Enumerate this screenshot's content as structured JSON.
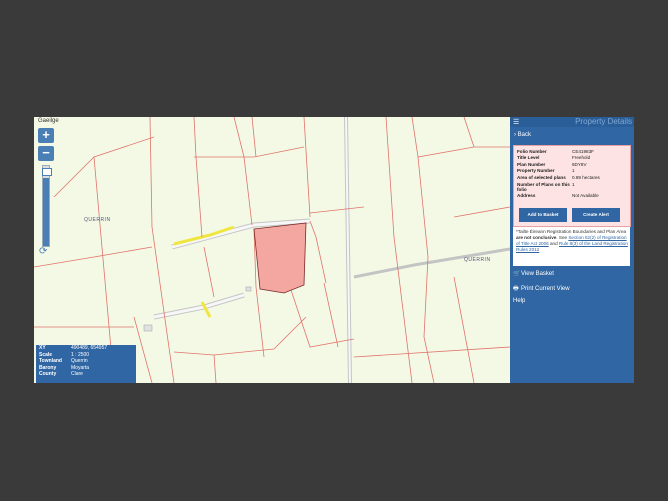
{
  "map": {
    "language_link": "Gaeilge",
    "zoom_in": "+",
    "zoom_out": "−",
    "refresh_icon": "⟳",
    "townland_labels": [
      "QUERRIN",
      "QUERRIN"
    ],
    "info": [
      {
        "key": "XY",
        "value": "490489, 654957"
      },
      {
        "key": "Scale",
        "value": "1 : 2500"
      },
      {
        "key": "Townland",
        "value": "Querrin"
      },
      {
        "key": "Barony",
        "value": "Moyarta"
      },
      {
        "key": "County",
        "value": "Clare"
      }
    ],
    "colors": {
      "background": "#f4f9e6",
      "parcel_line": "#e0736a",
      "selected_fill": "#f4a6a0",
      "road": "#b8b8b8",
      "highlight": "#f0e640"
    }
  },
  "panel": {
    "menu_icon": "☰",
    "title": "Property Details",
    "back_label": "Back",
    "back_icon": "›",
    "details": [
      {
        "key": "Folio Number",
        "value": "CE41983F"
      },
      {
        "key": "Title Level",
        "value": "Freehold"
      },
      {
        "key": "Plan Number",
        "value": "6DY8V"
      },
      {
        "key": "Property Number",
        "value": "1"
      },
      {
        "key": "Area of selected plans",
        "value": "0.89 hectares"
      },
      {
        "key": "Number of Plans on this folio",
        "value": "1"
      },
      {
        "key": "Address",
        "value": "Not Available"
      }
    ],
    "add_to_basket": "Add to Basket",
    "create_alert": "Create Alert",
    "note": {
      "text1": "*Tailte Éireann Registration Boundaries and Plan Area",
      "bold": "are not conclusive",
      "text2": ". See",
      "link1": "Section 62(2) of Registration of Title Act 2006",
      "text3": "and",
      "link2": "Rule 8(3) of the Land Registration Rules 2012"
    },
    "view_basket": "View Basket",
    "print_view": "Print Current View",
    "help": "Help",
    "colors": {
      "panel": "#2f66a3",
      "card": "#fde3e3"
    }
  }
}
